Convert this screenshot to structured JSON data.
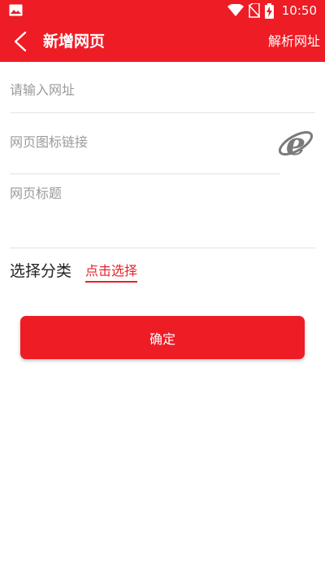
{
  "colors": {
    "brand": "#ee1c25",
    "link": "#e8222b"
  },
  "status_bar": {
    "time": "10:50",
    "icons": [
      "image-icon",
      "wifi-icon",
      "no-sim-icon",
      "battery-charging-icon"
    ]
  },
  "app_bar": {
    "back_icon": "back-arrow-icon",
    "title": "新增网页",
    "action_label": "解析网址"
  },
  "form": {
    "url_placeholder": "请输入网址",
    "url_value": "",
    "icon_link_placeholder": "网页图标链接",
    "icon_link_value": "",
    "title_placeholder": "网页标题",
    "title_value": "",
    "icon_preview": "ie-browser-icon",
    "category_label": "选择分类",
    "category_action": "点击选择"
  },
  "confirm_button": {
    "label": "确定"
  }
}
